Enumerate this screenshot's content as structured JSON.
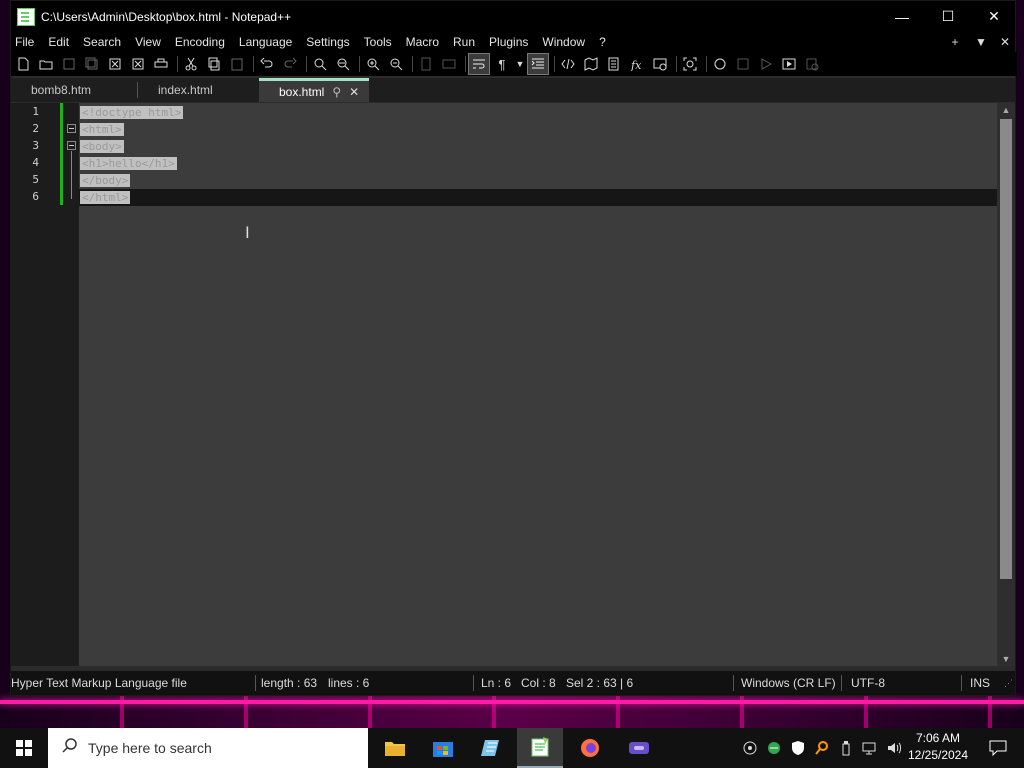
{
  "window": {
    "title": "C:\\Users\\Admin\\Desktop\\box.html - Notepad++",
    "controls": {
      "minimize": "—",
      "maximize": "☐",
      "close": "✕"
    }
  },
  "menu": {
    "items": [
      "File",
      "Edit",
      "Search",
      "View",
      "Encoding",
      "Language",
      "Settings",
      "Tools",
      "Macro",
      "Run",
      "Plugins",
      "Window",
      "?"
    ],
    "right": {
      "add": "+",
      "dropdown": "▼",
      "close": "✕"
    }
  },
  "tabs": [
    {
      "label": "bomb8.htm",
      "active": false
    },
    {
      "label": "index.html",
      "active": false
    },
    {
      "label": "box.html",
      "active": true,
      "pin": "⚲",
      "close": "✕"
    }
  ],
  "editor": {
    "line_numbers": [
      "1",
      "2",
      "3",
      "4",
      "5",
      "6"
    ],
    "lines": [
      "<!doctype html>",
      "<html>",
      "<body>",
      "<h1>hello</h1>",
      "</body>",
      "</html>"
    ],
    "cursor_glyph": "I"
  },
  "status": {
    "file_type": "Hyper Text Markup Language file",
    "length": "length : 63",
    "lines": "lines : 6",
    "ln": "Ln : 6",
    "col": "Col : 8",
    "sel": "Sel 2 : 63 | 6",
    "eol": "Windows (CR LF)",
    "encoding": "UTF-8",
    "mode": "INS"
  },
  "taskbar": {
    "search_placeholder": "Type here to search",
    "time": "7:06 AM",
    "date": "12/25/2024"
  },
  "colors": {
    "accent_tab": "#a6e2c1",
    "change_bar": "#1fb01f",
    "desktop_neon": "#ff1aa8"
  }
}
